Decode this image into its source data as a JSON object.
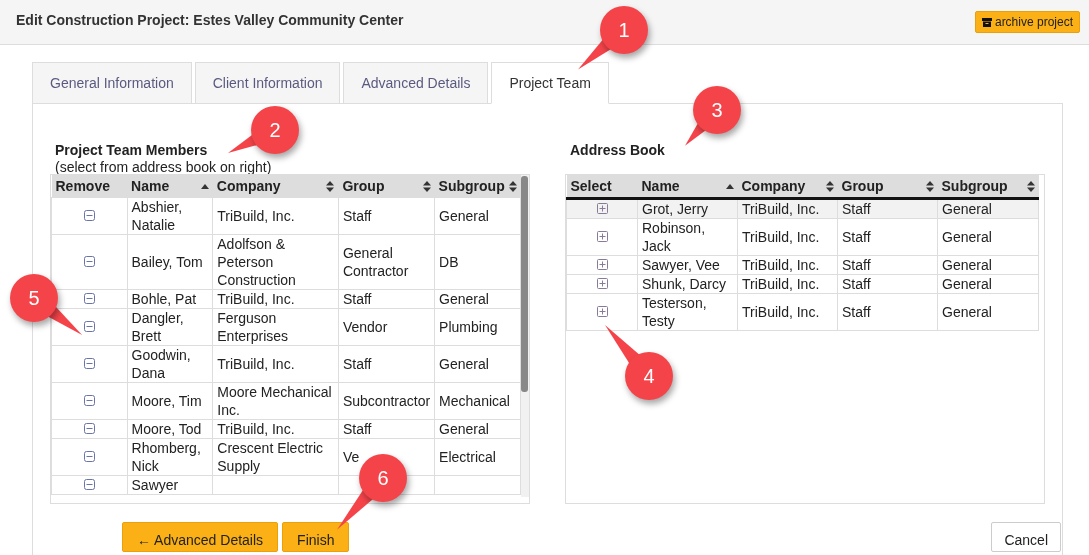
{
  "header": {
    "title": "Edit Construction Project: Estes Valley Community Center",
    "archive_button": "archive project"
  },
  "tabs": [
    {
      "label": "General Information",
      "selected": false
    },
    {
      "label": "Client Information",
      "selected": false
    },
    {
      "label": "Advanced Details",
      "selected": false
    },
    {
      "label": "Project Team",
      "selected": true
    }
  ],
  "team_members": {
    "title": "Project Team Members",
    "subtitle": "(select from address book on right)",
    "columns": [
      {
        "label": "Remove"
      },
      {
        "label": "Name",
        "sorted": true
      },
      {
        "label": "Company",
        "sorted": false
      },
      {
        "label": "Group",
        "sorted": false
      },
      {
        "label": "Subgroup",
        "sorted": false
      }
    ],
    "rows": [
      {
        "name": "Abshier, Natalie",
        "company": "TriBuild, Inc.",
        "group": "Staff",
        "subgroup": "General"
      },
      {
        "name": "Bailey, Tom",
        "company": "Adolfson & Peterson Construction",
        "group": "General Contractor",
        "subgroup": "DB"
      },
      {
        "name": "Bohle, Pat",
        "company": "TriBuild, Inc.",
        "group": "Staff",
        "subgroup": "General"
      },
      {
        "name": "Dangler, Brett",
        "company": "Ferguson Enterprises",
        "group": "Vendor",
        "subgroup": "Plumbing"
      },
      {
        "name": "Goodwin, Dana",
        "company": "TriBuild, Inc.",
        "group": "Staff",
        "subgroup": "General"
      },
      {
        "name": "Moore, Tim",
        "company": "Moore Mechanical Inc.",
        "group": "Subcontractor",
        "subgroup": "Mechanical"
      },
      {
        "name": "Moore, Tod",
        "company": "TriBuild, Inc.",
        "group": "Staff",
        "subgroup": "General"
      },
      {
        "name": "Rhomberg, Nick",
        "company": "Crescent Electric Supply",
        "group": "Ve",
        "subgroup": "Electrical"
      },
      {
        "name": "Sawyer"
      }
    ]
  },
  "address_book": {
    "title": "Address Book",
    "columns": [
      {
        "label": "Select"
      },
      {
        "label": "Name",
        "sorted": true
      },
      {
        "label": "Company",
        "sorted": false
      },
      {
        "label": "Group",
        "sorted": false
      },
      {
        "label": "Subgroup",
        "sorted": false
      }
    ],
    "rows": [
      {
        "name": "Grot, Jerry",
        "company": "TriBuild, Inc.",
        "group": "Staff",
        "subgroup": "General",
        "selected": true
      },
      {
        "name": "Robinson, Jack",
        "company": "TriBuild, Inc.",
        "group": "Staff",
        "subgroup": "General",
        "selected": false
      },
      {
        "name": "Sawyer, Vee",
        "company": "TriBuild, Inc.",
        "group": "Staff",
        "subgroup": "General",
        "selected": false
      },
      {
        "name": "Shunk, Darcy",
        "company": "TriBuild, Inc.",
        "group": "Staff",
        "subgroup": "General",
        "selected": false
      },
      {
        "name": "Testerson, Testy",
        "company": "TriBuild, Inc.",
        "group": "Staff",
        "subgroup": "General",
        "selected": false
      }
    ]
  },
  "buttons": {
    "back": "← Advanced Details",
    "finish": "Finish",
    "cancel": "Cancel"
  },
  "callouts": [
    "1",
    "2",
    "3",
    "4",
    "5",
    "6"
  ]
}
